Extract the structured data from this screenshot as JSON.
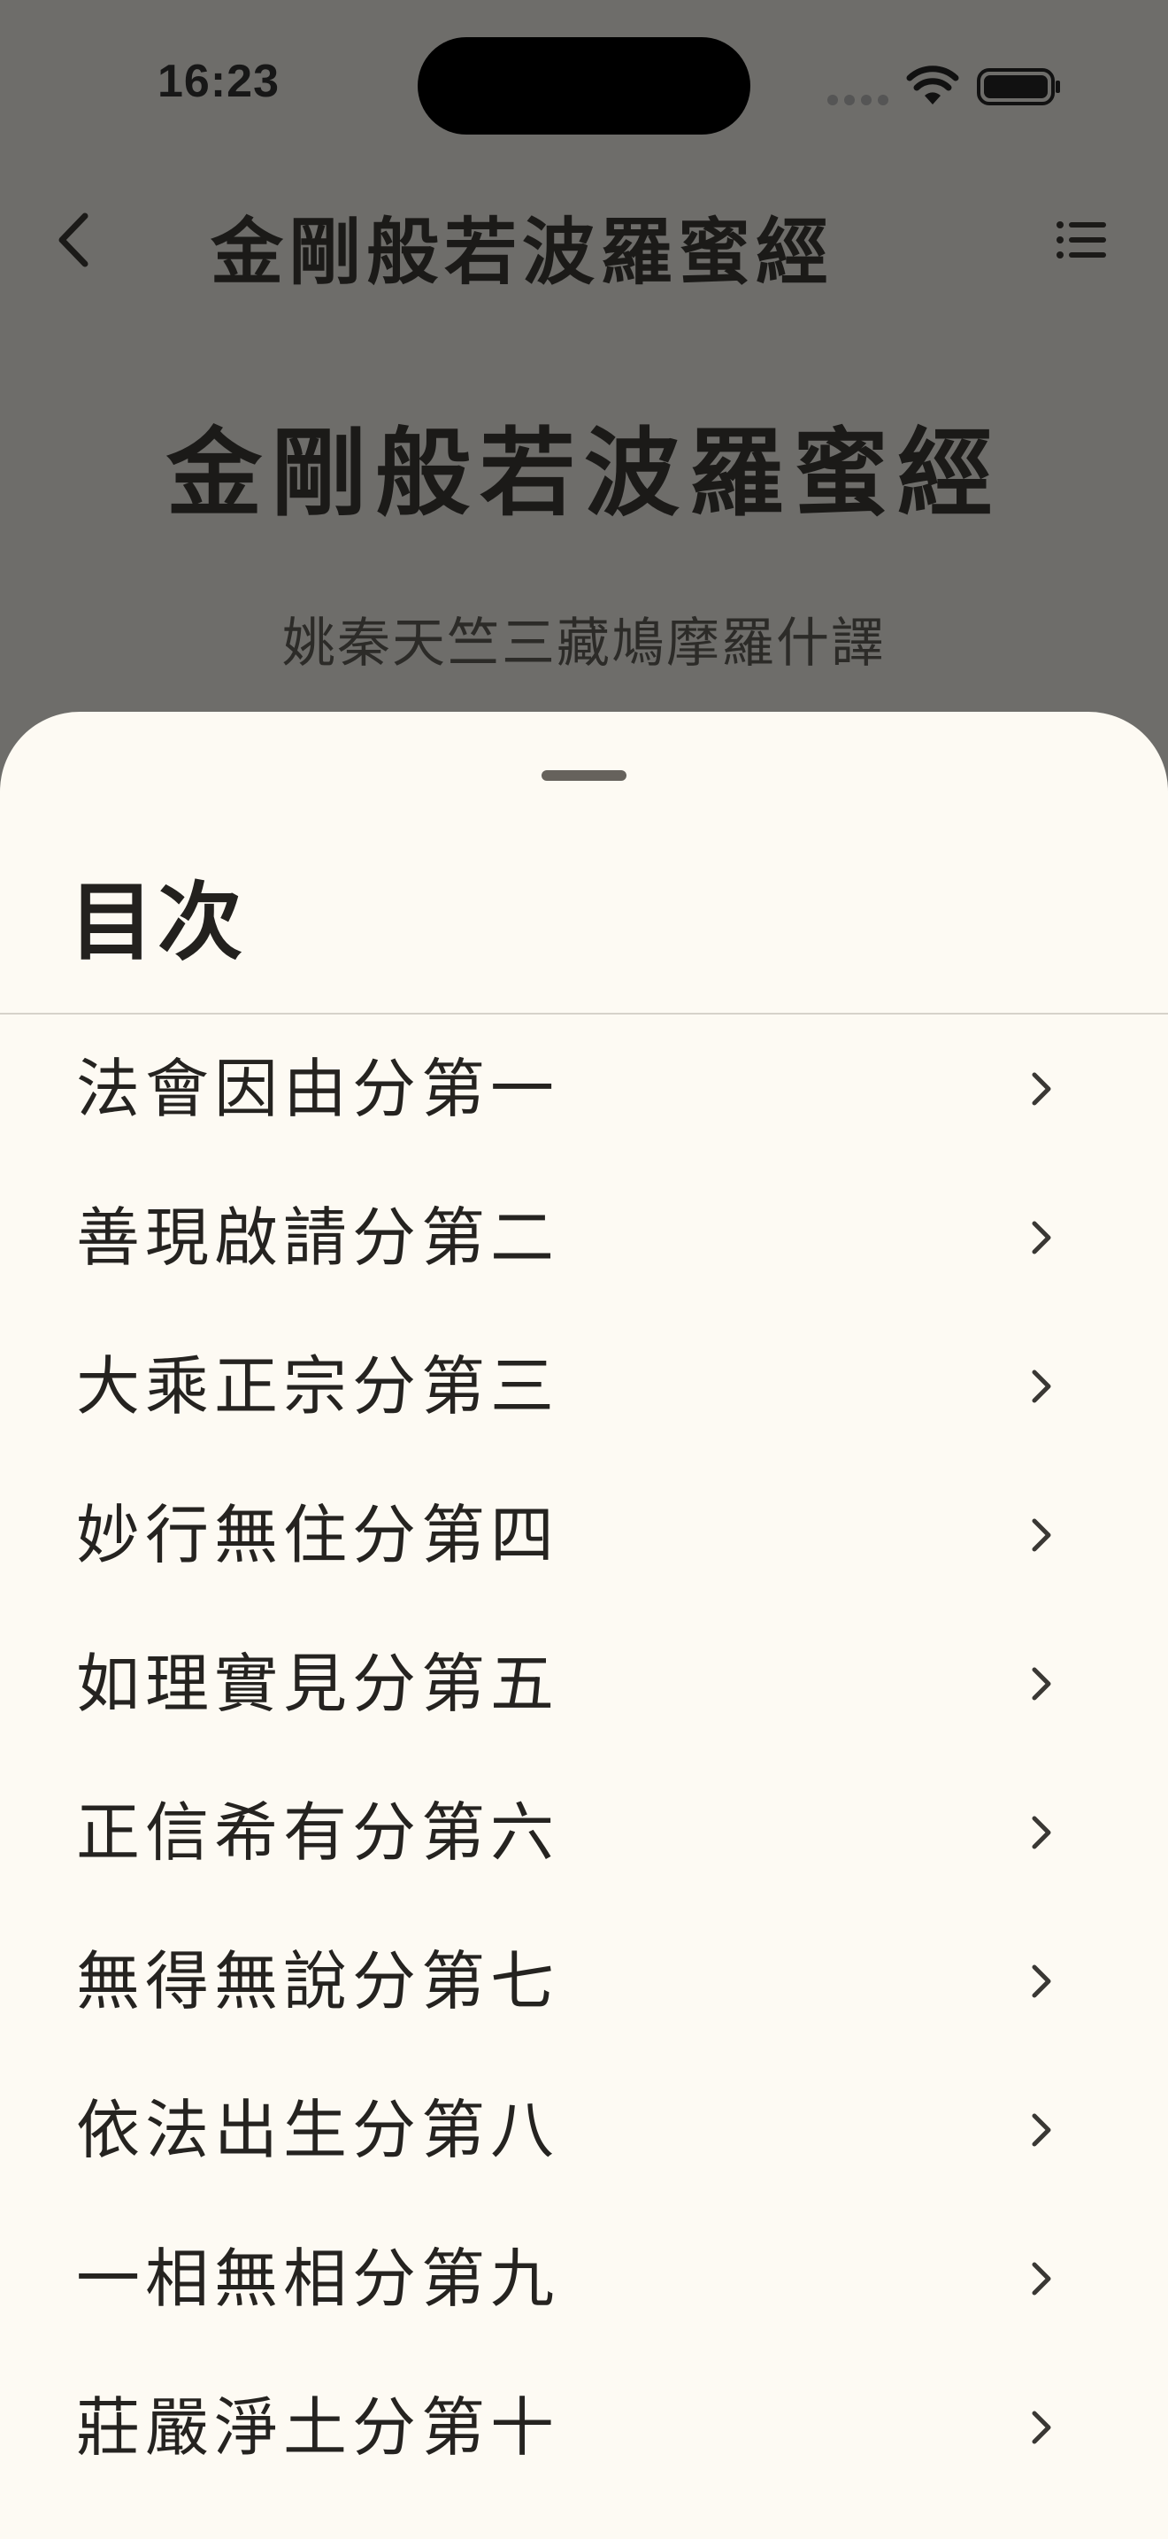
{
  "status_bar": {
    "time": "16:23"
  },
  "nav": {
    "title": "金剛般若波羅蜜經",
    "back_icon": "chevron-left-icon",
    "toc_icon": "list-icon"
  },
  "document": {
    "title": "金剛般若波羅蜜經",
    "subtitle": "姚秦天竺三藏鳩摩羅什譯"
  },
  "sheet": {
    "title": "目次",
    "items": [
      {
        "label": "法會因由分第一"
      },
      {
        "label": "善現啟請分第二"
      },
      {
        "label": "大乘正宗分第三"
      },
      {
        "label": "妙行無住分第四"
      },
      {
        "label": "如理實見分第五"
      },
      {
        "label": "正信希有分第六"
      },
      {
        "label": "無得無說分第七"
      },
      {
        "label": "依法出生分第八"
      },
      {
        "label": "一相無相分第九"
      },
      {
        "label": "莊嚴淨土分第十"
      }
    ]
  },
  "colors": {
    "sheet_background": "#fdfaf3",
    "dim_overlay": "#6e6d6a",
    "text_primary": "#252320"
  }
}
